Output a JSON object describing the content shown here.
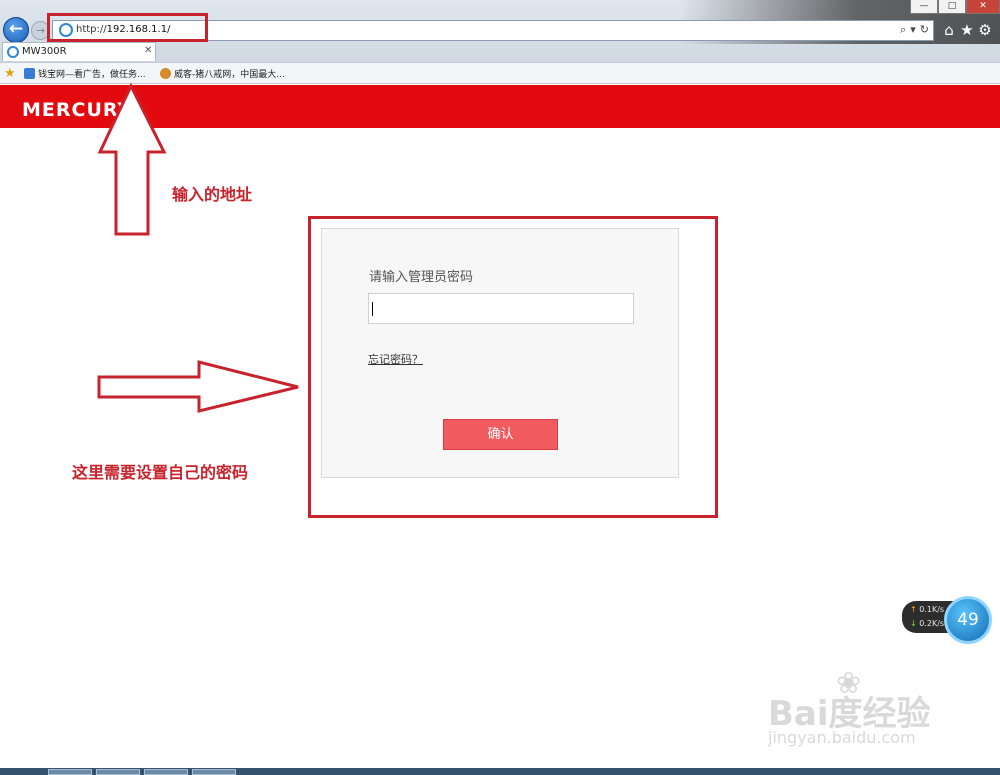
{
  "browser": {
    "url_prefix": "http://",
    "url_host": "192.168.1.1/",
    "back_glyph": "←",
    "forward_glyph": "→",
    "address_tools": [
      "⌕",
      "▾",
      "↻"
    ],
    "window_controls": [
      "—",
      "□",
      "✕"
    ],
    "tool_icons": [
      "⌂",
      "★",
      "⚙"
    ],
    "tab": {
      "label": "MW300R",
      "close": "✕"
    },
    "favorites": [
      {
        "label": "钱宝网—看广告，做任务...",
        "icon": "page-icon",
        "color": "#3a7bd5"
      },
      {
        "label": "威客-猪八戒网，中国最大...",
        "icon": "pig-icon",
        "color": "#d98a2a"
      }
    ]
  },
  "router": {
    "brand": "MERCURY",
    "login_label": "请输入管理员密码",
    "password_value": "",
    "forgot_label": "忘记密码？",
    "confirm_label": "确认",
    "brand_color": "#e20a0e",
    "button_color": "#f15b5f"
  },
  "annotations": {
    "address_note": "输入的地址",
    "password_note": "这里需要设置自己的密码",
    "color": "#c8232c"
  },
  "widgets": {
    "upload_speed": "0.1K/s",
    "download_speed": "0.2K/s",
    "percent": "49"
  },
  "watermark": {
    "main": "Bai度经验",
    "sub": "jingyan.baidu.com"
  }
}
